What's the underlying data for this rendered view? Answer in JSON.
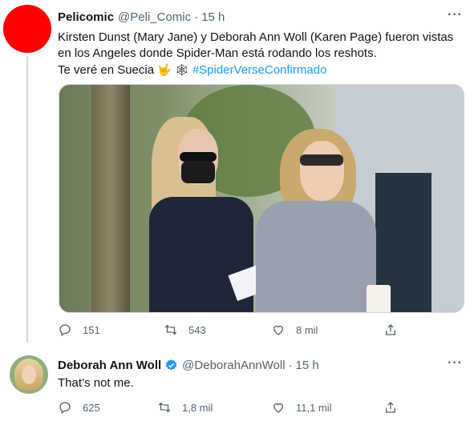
{
  "tweet1": {
    "name": "Pelicomic",
    "handle": "@Peli_Comic",
    "time": "15 h",
    "text_line1": "Kirsten Dunst (Mary Jane) y Deborah Ann Woll (Karen Page) fueron vistas",
    "text_line2": "en los Angeles donde Spider-Man está rodando los reshots.",
    "text_line3": "Te veré en Suecia",
    "emoji1": "🤟",
    "emoji2": "🕸",
    "hashtag": "#SpiderVerseConfirmado",
    "replies": "151",
    "retweets": "543",
    "likes": "8 mil",
    "more_icon": "more-icon"
  },
  "tweet2": {
    "name": "Deborah Ann Woll",
    "handle": "@DeborahAnnWoll",
    "time": "15 h",
    "text": "That’s not me.",
    "replies": "625",
    "retweets": "1,8 mil",
    "likes": "11,1 mil",
    "verified": true
  },
  "colors": {
    "accent": "#1d9bf0",
    "secondary_text": "#536471",
    "avatar1": "#ff0000"
  }
}
